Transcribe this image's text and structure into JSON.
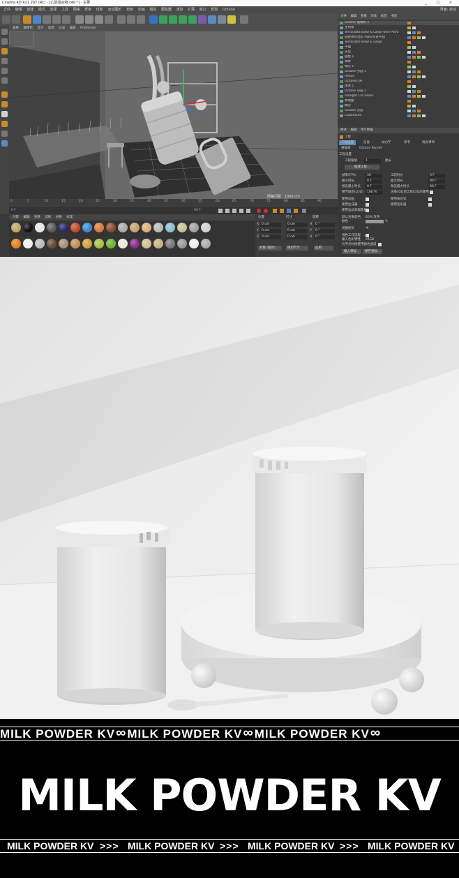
{
  "window": {
    "title": "Cinema 4D R21.207 (RC) - [乙醇混合物.c4d *] - 主要",
    "controls": "_ □ ×"
  },
  "menubar": {
    "items": [
      "文件",
      "编辑",
      "创建",
      "模式",
      "选择",
      "工具",
      "网格",
      "样条",
      "体积",
      "运动图形",
      "角色",
      "动画",
      "模拟",
      "跟踪器",
      "渲染",
      "扩展",
      "窗口",
      "帮助",
      "Octane"
    ],
    "right": "界面: 启动"
  },
  "viewport": {
    "menu": [
      "查看",
      "摄像机",
      "显示",
      "选项",
      "过滤",
      "面板",
      "ProRender"
    ],
    "info": "网格间距 : 1000 cm"
  },
  "timeline": {
    "frames": [
      "0",
      "5",
      "10",
      "15",
      "20",
      "25",
      "30",
      "35",
      "40",
      "45",
      "50",
      "55",
      "60",
      "65",
      "70",
      "75",
      "80",
      "85",
      "90"
    ],
    "current": "0 F",
    "end": "90 F"
  },
  "materials": {
    "tabs": [
      "创建",
      "编辑",
      "查看",
      "选择",
      "材质",
      "纹理"
    ],
    "colors": [
      "#bfa66a",
      "#111111",
      "#e6e6e6",
      "#5a5a5a",
      "#2a2a6a",
      "#c44a2a",
      "#3a8ad6",
      "#d97a3a",
      "#8a4a2a",
      "#aaaaaa",
      "#c7a070",
      "#d8b078",
      "#b8b8b8",
      "#8abcd0",
      "#c8c090",
      "#a0a0a0",
      "#d0d0d0",
      "#e08020",
      "#f0f0f0",
      "#bbbbbb",
      "#6a4a3a",
      "#a89070",
      "#c09050",
      "#d0a040",
      "#a8c040",
      "#70b030",
      "#e8e8d8",
      "#8a2a8a",
      "#d0c090",
      "#c8b080",
      "#777777",
      "#999999",
      "#eeeeee",
      "#aaaaaa"
    ]
  },
  "coords": {
    "headers": [
      "位置",
      "尺寸",
      "旋转"
    ],
    "rows": [
      {
        "axis": "X",
        "pos": "0 cm",
        "size": "0 cm",
        "rot": "H",
        "rot_val": "0 °"
      },
      {
        "axis": "Y",
        "pos": "0 cm",
        "size": "0 cm",
        "rot": "P",
        "rot_val": "0 °"
      },
      {
        "axis": "Z",
        "pos": "0 cm",
        "size": "0 cm",
        "rot": "B",
        "rot_val": "0 °"
      }
    ],
    "mode": "对象 (相对)",
    "size_mode": "绝对尺寸",
    "apply": "应用"
  },
  "objects": {
    "tabs": [
      "文件",
      "编辑",
      "查看",
      "对象",
      "标签",
      "书签"
    ],
    "rows": [
      "Octane 摄像机.1",
      "主场景",
      "Terracotta Bowl & Large with Plant",
      "圆柱体和台阶 HDRI背景平面",
      "Terracotta Bowl & Large",
      "平面",
      "天空",
      "圆柱.1",
      "球体",
      "细分.1",
      "Octane 分层.1",
      "Helios",
      "Octane灯光",
      "球体.1",
      "Octane 分层.2",
      "Straight Cut Grass",
      "草地面",
      "细分",
      "Octane 分层",
      "Capitalium"
    ]
  },
  "attributes": {
    "tabs": [
      "模式",
      "编辑",
      "用户数据"
    ],
    "heading": "工程",
    "subtabs": [
      "工程设置",
      "信息",
      "动力学",
      "参考",
      "待办事项",
      "帧插值",
      "Octane Render"
    ],
    "section": "工程设置",
    "scale_label": "工程缩放",
    "scale_value": "1",
    "scale_unit": "厘米",
    "scale_button": "缩放工程...",
    "fields": [
      {
        "label": "帧率(FPS)",
        "value": "30"
      },
      {
        "label": "最小时长",
        "value": "0 F"
      },
      {
        "label": "预览最小时长",
        "value": "0 F"
      },
      {
        "label": "细节级别(LOD)",
        "value": "100 %"
      }
    ],
    "fields_right": [
      {
        "label": "工程时长",
        "value": "0 F"
      },
      {
        "label": "最大时长",
        "value": "90 F"
      },
      {
        "label": "预览最大时长",
        "value": "90 F"
      }
    ],
    "lod_note": "渲染LOD到工程LOD的使用",
    "checks": [
      "使用动画",
      "使用生成器",
      "使用运动剪辑系统"
    ],
    "checks_right": [
      "使用表达式",
      "使用变形器"
    ],
    "default_color_label": "默认对象颜色",
    "default_color_value": "60% 灰色",
    "color_label": "颜色",
    "view_clip_label": "视图修剪",
    "view_clip_value": "中",
    "linear_label": "线性工作流程",
    "input_color_label": "输入色彩特性",
    "input_color_value": "sRGB",
    "node_label": "为节点材质使用颜色通道",
    "load_button": "载入预设...",
    "save_button": "保存预设..."
  },
  "banner": {
    "ticker_text": "MILK POWDER KV",
    "infinity": "∞",
    "title": "MILK POWDER KV",
    "bottom_text": "MILK POWDER KV",
    "arrows": ">>>"
  }
}
